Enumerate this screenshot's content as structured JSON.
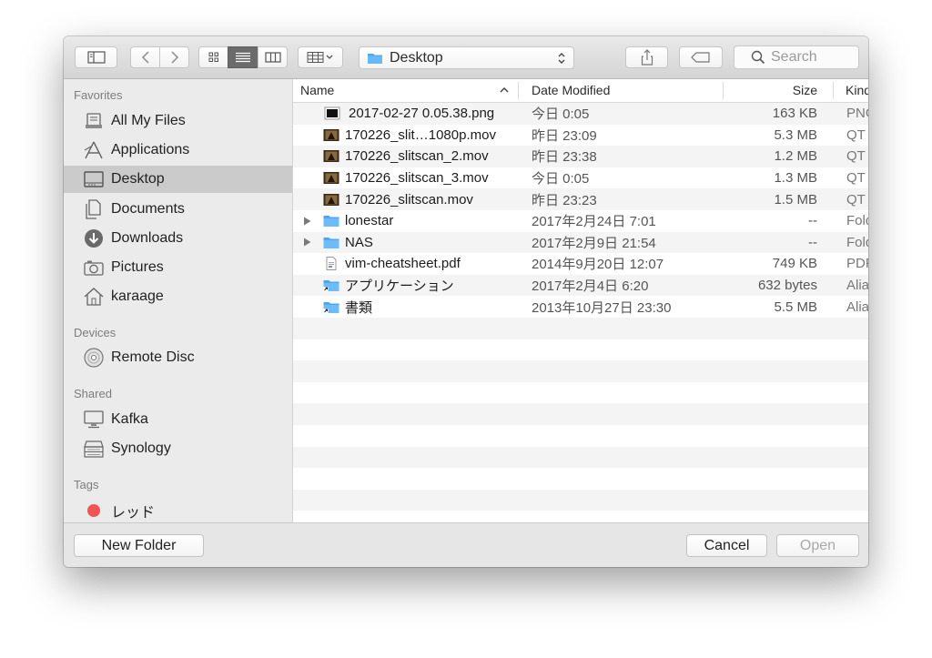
{
  "toolbar": {
    "location": "Desktop",
    "search_placeholder": "Search"
  },
  "sidebar": {
    "favorites_header": "Favorites",
    "favorites": [
      {
        "label": "All My Files",
        "icon": "all-files-icon"
      },
      {
        "label": "Applications",
        "icon": "applications-icon"
      },
      {
        "label": "Desktop",
        "icon": "desktop-icon",
        "selected": true
      },
      {
        "label": "Documents",
        "icon": "documents-icon"
      },
      {
        "label": "Downloads",
        "icon": "downloads-icon"
      },
      {
        "label": "Pictures",
        "icon": "pictures-icon"
      },
      {
        "label": "karaage",
        "icon": "home-icon"
      }
    ],
    "devices_header": "Devices",
    "devices": [
      {
        "label": "Remote Disc",
        "icon": "disc-icon"
      }
    ],
    "shared_header": "Shared",
    "shared": [
      {
        "label": "Kafka",
        "icon": "computer-icon"
      },
      {
        "label": "Synology",
        "icon": "server-icon"
      }
    ],
    "tags_header": "Tags",
    "tags": [
      {
        "label": "レッド",
        "color": "#f05552"
      }
    ]
  },
  "columns": {
    "name": "Name",
    "date": "Date Modified",
    "size": "Size",
    "kind": "Kind"
  },
  "files": [
    {
      "name": "2017-02-27 0.05.38.png",
      "date": "今日 0:05",
      "size": "163 KB",
      "kind": "PNG",
      "icon": "image-file-icon"
    },
    {
      "name": "170226_slit…1080p.mov",
      "date": "昨日 23:09",
      "size": "5.3 MB",
      "kind": "QT",
      "icon": "movie-file-icon"
    },
    {
      "name": "170226_slitscan_2.mov",
      "date": "昨日 23:38",
      "size": "1.2 MB",
      "kind": "QT",
      "icon": "movie-file-icon"
    },
    {
      "name": "170226_slitscan_3.mov",
      "date": "今日 0:05",
      "size": "1.3 MB",
      "kind": "QT",
      "icon": "movie-file-icon"
    },
    {
      "name": "170226_slitscan.mov",
      "date": "昨日 23:23",
      "size": "1.5 MB",
      "kind": "QT",
      "icon": "movie-file-icon"
    },
    {
      "name": "lonestar",
      "date": "2017年2月24日 7:01",
      "size": "--",
      "kind": "Fold",
      "icon": "folder-icon",
      "folder": true
    },
    {
      "name": "NAS",
      "date": "2017年2月9日 21:54",
      "size": "--",
      "kind": "Fold",
      "icon": "folder-icon",
      "folder": true
    },
    {
      "name": "vim-cheatsheet.pdf",
      "date": "2014年9月20日 12:07",
      "size": "749 KB",
      "kind": "PDF",
      "icon": "pdf-file-icon"
    },
    {
      "name": "アプリケーション",
      "date": "2017年2月4日 6:20",
      "size": "632 bytes",
      "kind": "Alia",
      "icon": "alias-folder-icon"
    },
    {
      "name": "書類",
      "date": "2013年10月27日 23:30",
      "size": "5.5 MB",
      "kind": "Alia",
      "icon": "alias-folder-icon"
    }
  ],
  "buttons": {
    "new_folder": "New Folder",
    "cancel": "Cancel",
    "open": "Open"
  }
}
